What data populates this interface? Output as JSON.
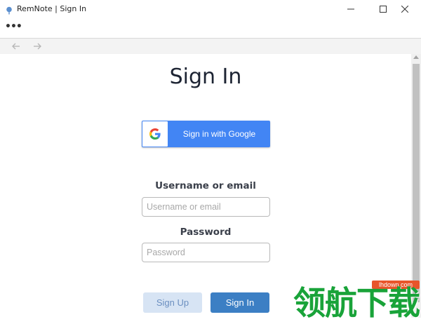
{
  "window": {
    "title": "RemNote | Sign In",
    "minimize_icon": "minimize-icon",
    "maximize_icon": "maximize-icon",
    "close_icon": "close-icon"
  },
  "menu": {
    "more_icon": "more-dots-icon"
  },
  "nav": {
    "back_icon": "arrow-left-icon",
    "forward_icon": "arrow-right-icon"
  },
  "signin": {
    "title": "Sign In",
    "google_label": "Sign in with Google",
    "username_label": "Username or email",
    "username_placeholder": "Username or email",
    "password_label": "Password",
    "password_placeholder": "Password",
    "signup_button": "Sign Up",
    "signin_button": "Sign In"
  },
  "colors": {
    "google_blue": "#4285f4",
    "signin_blue": "#3c7fc4",
    "signup_light": "#d7e4f4"
  },
  "watermark": {
    "url": "lhdown.com",
    "text": "领航下载"
  }
}
